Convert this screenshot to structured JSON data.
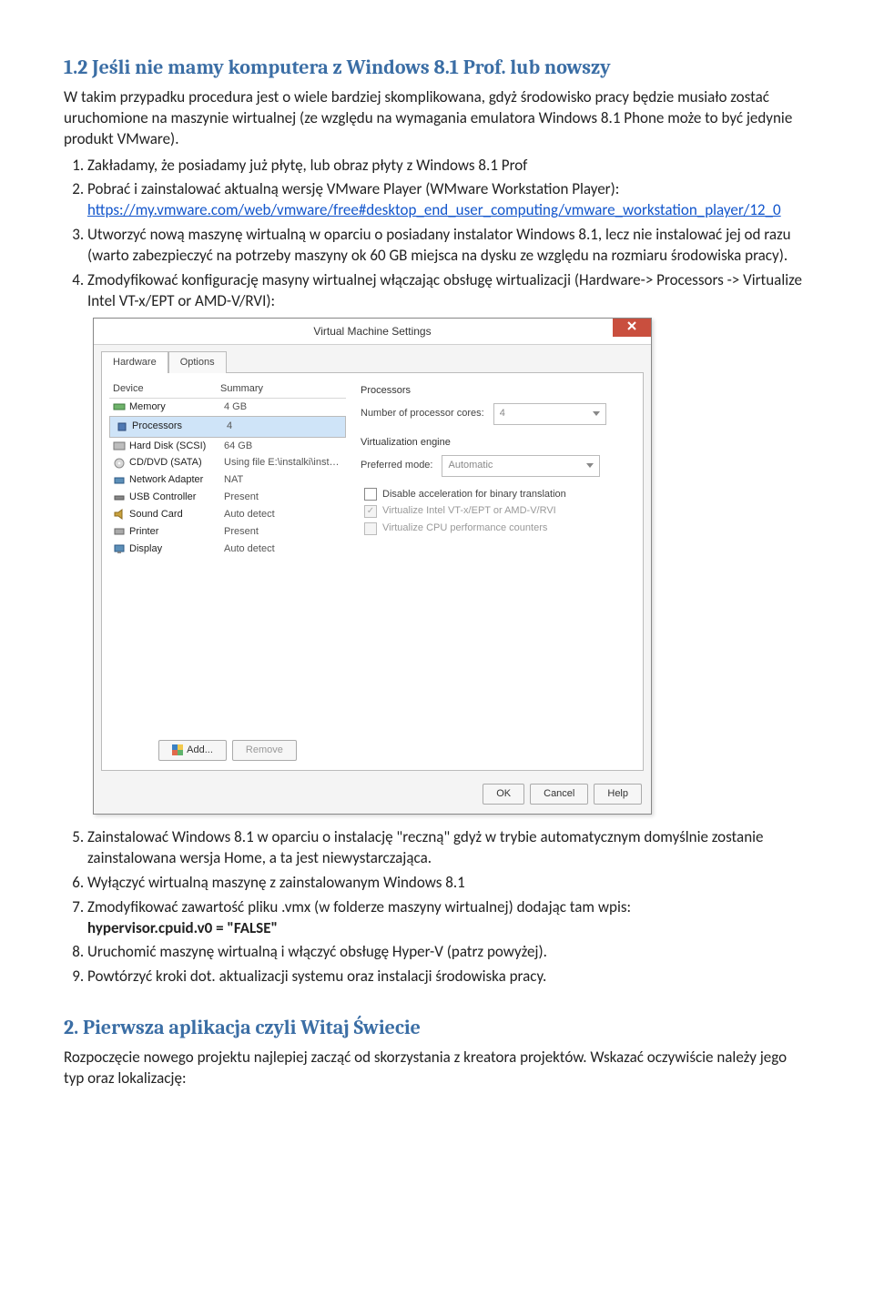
{
  "doc": {
    "heading1": "1.2 Jeśli nie mamy komputera z Windows 8.1 Prof. lub nowszy",
    "p1": "W takim przypadku procedura jest o wiele bardziej skomplikowana, gdyż środowisko pracy będzie musiało zostać uruchomione na maszynie wirtualnej (ze względu na wymagania emulatora Windows 8.1 Phone  może to być jedynie produkt VMware).",
    "li1": "Zakładamy, że posiadamy już płytę, lub obraz płyty z Windows 8.1 Prof",
    "li2a": "Pobrać i zainstalować aktualną wersję VMware Player (WMware Workstation  Player): ",
    "li2link": "https://my.vmware.com/web/vmware/free#desktop_end_user_computing/vmware_workstation_player/12_0",
    "li3": "Utworzyć nową maszynę  wirtualną w oparciu o posiadany instalator Windows 8.1, lecz nie instalować jej od razu  (warto zabezpieczyć na potrzeby maszyny ok 60 GB miejsca na dysku ze względu na rozmiaru środowiska pracy).",
    "li4": "Zmodyfikować konfigurację masyny wirtualnej włączając obsługę wirtualizacji (Hardware-> Processors -> Virtualize  Intel VT-x/EPT or AMD-V/RVI):",
    "li5": "Zainstalować Windows 8.1 w oparciu  o instalację \"reczną\" gdyż w trybie automatycznym domyślnie zostanie zainstalowana wersja Home, a ta jest niewystarczająca.",
    "li6": "Wyłączyć wirtualną maszynę z zainstalowanym Windows 8.1",
    "li7a": "Zmodyfikować zawartość pliku .vmx (w folderze maszyny wirtualnej) dodając tam wpis: ",
    "li7b": "hypervisor.cpuid.v0 = \"FALSE\"",
    "li8": "Uruchomić maszynę wirtualną i włączyć obsługę Hyper-V (patrz powyżej).",
    "li9": "Powtórzyć kroki dot. aktualizacji systemu oraz instalacji środowiska pracy.",
    "heading2": "2. Pierwsza aplikacja czyli Witaj Świecie",
    "p2": "Rozpoczęcie nowego projektu najlepiej zacząć od skorzystania z kreatora projektów.  Wskazać oczywiście należy jego typ oraz lokalizację:"
  },
  "dlg": {
    "title": "Virtual Machine Settings",
    "tabs": {
      "hw": "Hardware",
      "opt": "Options"
    },
    "heads": {
      "device": "Device",
      "summary": "Summary"
    },
    "rows": [
      {
        "icon": "memory",
        "d": "Memory",
        "s": "4 GB"
      },
      {
        "icon": "cpu",
        "d": "Processors",
        "s": "4",
        "sel": true
      },
      {
        "icon": "hdd",
        "d": "Hard Disk (SCSI)",
        "s": "64 GB"
      },
      {
        "icon": "cd",
        "d": "CD/DVD (SATA)",
        "s": "Using file E:\\instalki\\instalki_pwsz\\..."
      },
      {
        "icon": "net",
        "d": "Network Adapter",
        "s": "NAT"
      },
      {
        "icon": "usb",
        "d": "USB Controller",
        "s": "Present"
      },
      {
        "icon": "snd",
        "d": "Sound Card",
        "s": "Auto detect"
      },
      {
        "icon": "prn",
        "d": "Printer",
        "s": "Present"
      },
      {
        "icon": "dsp",
        "d": "Display",
        "s": "Auto detect"
      }
    ],
    "add": "Add...",
    "remove": "Remove",
    "procs_grp": "Processors",
    "cores_lbl": "Number of processor cores:",
    "cores_val": "4",
    "virt_grp": "Virtualization engine",
    "pref_lbl": "Preferred mode:",
    "pref_val": "Automatic",
    "chk1": "Disable acceleration for binary translation",
    "chk2": "Virtualize Intel VT-x/EPT or AMD-V/RVI",
    "chk3": "Virtualize CPU performance counters",
    "ok": "OK",
    "cancel": "Cancel",
    "help": "Help"
  }
}
